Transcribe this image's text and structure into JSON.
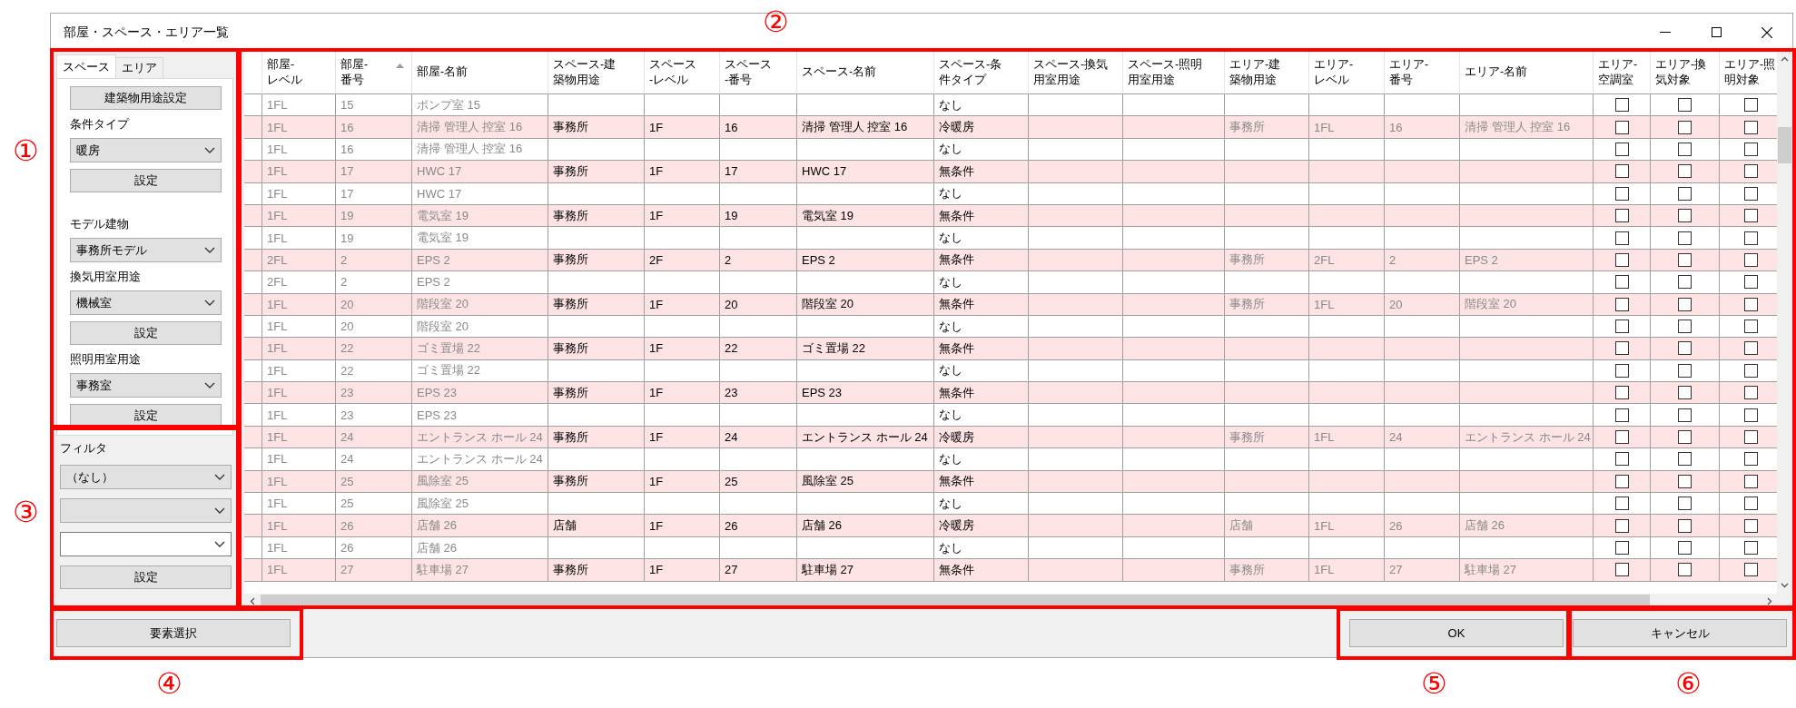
{
  "window": {
    "title": "部屋・スペース・エリア一覧"
  },
  "tabs": [
    {
      "label": "スペース",
      "selected": true
    },
    {
      "label": "エリア",
      "selected": false
    }
  ],
  "space_panel": [
    {
      "kind": "button",
      "text": "建築物用途設定"
    },
    {
      "kind": "label",
      "text": "条件タイプ"
    },
    {
      "kind": "dropdown",
      "value": "暖房"
    },
    {
      "kind": "button",
      "text": "設定"
    },
    {
      "kind": "gap"
    },
    {
      "kind": "label",
      "text": "モデル建物"
    },
    {
      "kind": "dropdown",
      "value": "事務所モデル"
    },
    {
      "kind": "label",
      "text": "換気用室用途"
    },
    {
      "kind": "dropdown",
      "value": "機械室"
    },
    {
      "kind": "button",
      "text": "設定"
    },
    {
      "kind": "label",
      "text": "照明用室用途"
    },
    {
      "kind": "dropdown",
      "value": "事務室"
    },
    {
      "kind": "button",
      "text": "設定"
    }
  ],
  "filter_panel": [
    {
      "kind": "label",
      "text": "フィルタ"
    },
    {
      "kind": "dropdown",
      "value": "（なし）"
    },
    {
      "kind": "dropdown"
    },
    {
      "kind": "combo"
    },
    {
      "kind": "button",
      "text": "設定"
    }
  ],
  "table": {
    "columns": [
      {
        "lines": [
          "部屋-",
          "レベル"
        ],
        "kind": "linked"
      },
      {
        "lines": [
          "部屋-",
          "番号"
        ],
        "kind": "linked",
        "sorted": true
      },
      {
        "lines": [
          "部屋-名前"
        ],
        "kind": "linked"
      },
      {
        "lines": [
          "スペース-建",
          "築物用途"
        ],
        "kind": "text"
      },
      {
        "lines": [
          "スペース",
          "-レベル"
        ],
        "kind": "text"
      },
      {
        "lines": [
          "スペース",
          "-番号"
        ],
        "kind": "text"
      },
      {
        "lines": [
          "スペース-名前"
        ],
        "kind": "text"
      },
      {
        "lines": [
          "スペース-条",
          "件タイプ"
        ],
        "kind": "text"
      },
      {
        "lines": [
          "スペース-換気",
          "用室用途"
        ],
        "kind": "text"
      },
      {
        "lines": [
          "スペース-照明",
          "用室用途"
        ],
        "kind": "text"
      },
      {
        "lines": [
          "エリア-建",
          "築物用途"
        ],
        "kind": "linked"
      },
      {
        "lines": [
          "エリア-",
          "レベル"
        ],
        "kind": "linked"
      },
      {
        "lines": [
          "エリア-",
          "番号"
        ],
        "kind": "linked"
      },
      {
        "lines": [
          "エリア-名前"
        ],
        "kind": "linked"
      },
      {
        "lines": [
          "エリア-",
          "空調室"
        ],
        "kind": "check"
      },
      {
        "lines": [
          "エリア-換",
          "気対象"
        ],
        "kind": "check"
      },
      {
        "lines": [
          "エリア-照",
          "明対象"
        ],
        "kind": "check"
      }
    ],
    "rows": [
      {
        "highlighted": false,
        "cells": [
          "1FL",
          "15",
          "ポンプ室 15",
          null,
          null,
          null,
          null,
          "なし",
          null,
          null,
          null,
          null,
          null,
          null,
          false,
          false,
          false
        ]
      },
      {
        "highlighted": true,
        "cells": [
          "1FL",
          "16",
          "清掃 管理人 控室 16",
          "事務所",
          "1F",
          "16",
          "清掃 管理人 控室 16",
          "冷暖房",
          null,
          null,
          "事務所",
          "1FL",
          "16",
          "清掃 管理人 控室 16",
          false,
          false,
          false
        ]
      },
      {
        "highlighted": false,
        "cells": [
          "1FL",
          "16",
          "清掃 管理人 控室 16",
          null,
          null,
          null,
          null,
          "なし",
          null,
          null,
          null,
          null,
          null,
          null,
          false,
          false,
          false
        ]
      },
      {
        "highlighted": true,
        "cells": [
          "1FL",
          "17",
          "HWC 17",
          "事務所",
          "1F",
          "17",
          "HWC 17",
          "無条件",
          null,
          null,
          null,
          null,
          null,
          null,
          false,
          false,
          false
        ]
      },
      {
        "highlighted": false,
        "cells": [
          "1FL",
          "17",
          "HWC 17",
          null,
          null,
          null,
          null,
          "なし",
          null,
          null,
          null,
          null,
          null,
          null,
          false,
          false,
          false
        ]
      },
      {
        "highlighted": true,
        "cells": [
          "1FL",
          "19",
          "電気室 19",
          "事務所",
          "1F",
          "19",
          "電気室 19",
          "無条件",
          null,
          null,
          null,
          null,
          null,
          null,
          false,
          false,
          false
        ]
      },
      {
        "highlighted": false,
        "cells": [
          "1FL",
          "19",
          "電気室 19",
          null,
          null,
          null,
          null,
          "なし",
          null,
          null,
          null,
          null,
          null,
          null,
          false,
          false,
          false
        ]
      },
      {
        "highlighted": true,
        "cells": [
          "2FL",
          "2",
          "EPS 2",
          "事務所",
          "2F",
          "2",
          "EPS 2",
          "無条件",
          null,
          null,
          "事務所",
          "2FL",
          "2",
          "EPS 2",
          false,
          false,
          false
        ]
      },
      {
        "highlighted": false,
        "cells": [
          "2FL",
          "2",
          "EPS 2",
          null,
          null,
          null,
          null,
          "なし",
          null,
          null,
          null,
          null,
          null,
          null,
          false,
          false,
          false
        ]
      },
      {
        "highlighted": true,
        "cells": [
          "1FL",
          "20",
          "階段室 20",
          "事務所",
          "1F",
          "20",
          "階段室 20",
          "無条件",
          null,
          null,
          "事務所",
          "1FL",
          "20",
          "階段室 20",
          false,
          false,
          false
        ]
      },
      {
        "highlighted": false,
        "cells": [
          "1FL",
          "20",
          "階段室 20",
          null,
          null,
          null,
          null,
          "なし",
          null,
          null,
          null,
          null,
          null,
          null,
          false,
          false,
          false
        ]
      },
      {
        "highlighted": true,
        "cells": [
          "1FL",
          "22",
          "ゴミ置場 22",
          "事務所",
          "1F",
          "22",
          "ゴミ置場 22",
          "無条件",
          null,
          null,
          null,
          null,
          null,
          null,
          false,
          false,
          false
        ]
      },
      {
        "highlighted": false,
        "cells": [
          "1FL",
          "22",
          "ゴミ置場 22",
          null,
          null,
          null,
          null,
          "なし",
          null,
          null,
          null,
          null,
          null,
          null,
          false,
          false,
          false
        ]
      },
      {
        "highlighted": true,
        "cells": [
          "1FL",
          "23",
          "EPS 23",
          "事務所",
          "1F",
          "23",
          "EPS 23",
          "無条件",
          null,
          null,
          null,
          null,
          null,
          null,
          false,
          false,
          false
        ]
      },
      {
        "highlighted": false,
        "cells": [
          "1FL",
          "23",
          "EPS 23",
          null,
          null,
          null,
          null,
          "なし",
          null,
          null,
          null,
          null,
          null,
          null,
          false,
          false,
          false
        ]
      },
      {
        "highlighted": true,
        "cells": [
          "1FL",
          "24",
          "エントランス ホール 24",
          "事務所",
          "1F",
          "24",
          "エントランス ホール 24",
          "冷暖房",
          null,
          null,
          "事務所",
          "1FL",
          "24",
          "エントランス ホール 24",
          false,
          false,
          false
        ]
      },
      {
        "highlighted": false,
        "cells": [
          "1FL",
          "24",
          "エントランス ホール 24",
          null,
          null,
          null,
          null,
          "なし",
          null,
          null,
          null,
          null,
          null,
          null,
          false,
          false,
          false
        ]
      },
      {
        "highlighted": true,
        "cells": [
          "1FL",
          "25",
          "風除室 25",
          "事務所",
          "1F",
          "25",
          "風除室 25",
          "無条件",
          null,
          null,
          null,
          null,
          null,
          null,
          false,
          false,
          false
        ]
      },
      {
        "highlighted": false,
        "cells": [
          "1FL",
          "25",
          "風除室 25",
          null,
          null,
          null,
          null,
          "なし",
          null,
          null,
          null,
          null,
          null,
          null,
          false,
          false,
          false
        ]
      },
      {
        "highlighted": true,
        "cells": [
          "1FL",
          "26",
          "店舗 26",
          "店舗",
          "1F",
          "26",
          "店舗 26",
          "冷暖房",
          null,
          null,
          "店舗",
          "1FL",
          "26",
          "店舗 26",
          false,
          false,
          false
        ]
      },
      {
        "highlighted": false,
        "cells": [
          "1FL",
          "26",
          "店舗 26",
          null,
          null,
          null,
          null,
          "なし",
          null,
          null,
          null,
          null,
          null,
          null,
          false,
          false,
          false
        ]
      },
      {
        "highlighted": true,
        "cells": [
          "1FL",
          "27",
          "駐車場 27",
          "事務所",
          "1F",
          "27",
          "駐車場 27",
          "無条件",
          null,
          null,
          "事務所",
          "1FL",
          "27",
          "駐車場 27",
          false,
          false,
          false
        ]
      }
    ]
  },
  "bottom_buttons": [
    {
      "text": "要素選択",
      "kind": "left"
    },
    {
      "text": "OK",
      "kind": "right"
    },
    {
      "text": "キャンセル",
      "kind": "right"
    }
  ],
  "annotations": [
    {
      "label": "①"
    },
    {
      "label": "②"
    },
    {
      "label": "③"
    },
    {
      "label": "④"
    },
    {
      "label": "⑤"
    },
    {
      "label": "⑥"
    }
  ]
}
